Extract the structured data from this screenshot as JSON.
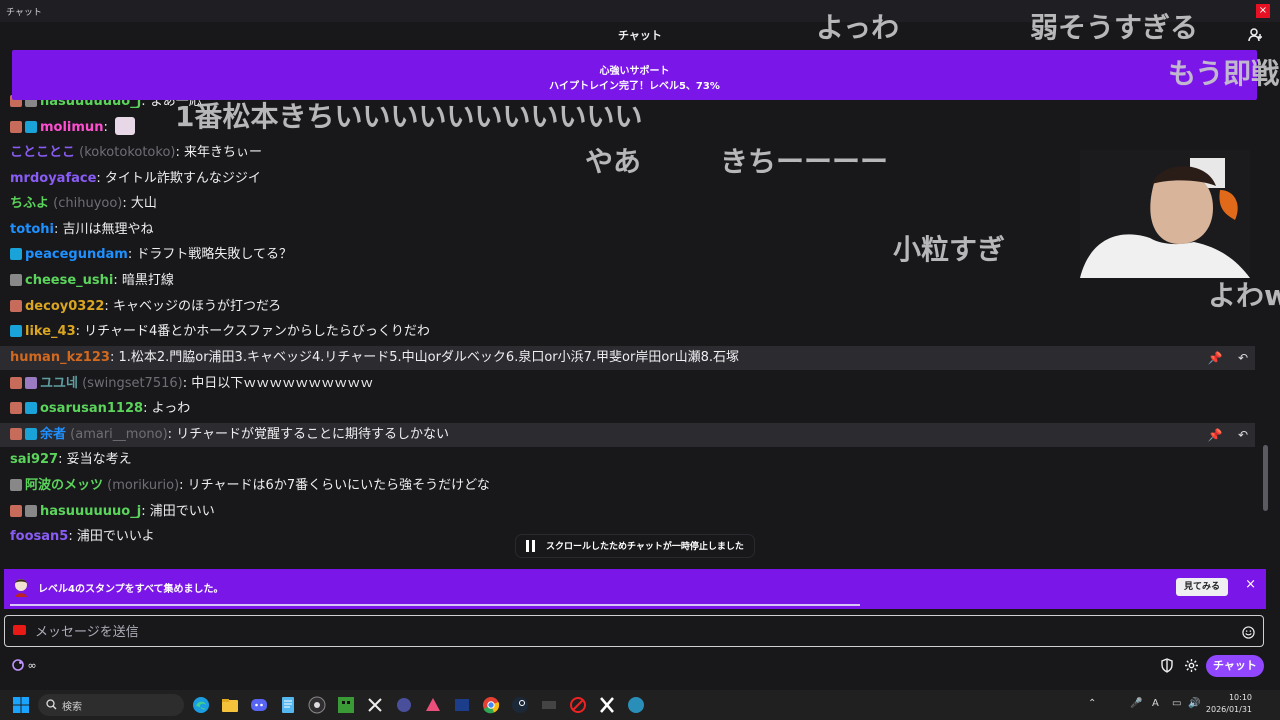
{
  "window": {
    "title": "チャット",
    "close": "×"
  },
  "header": {
    "title": "チャット"
  },
  "hype_train": {
    "line1": "心強いサポート",
    "line2": "ハイプトレイン完了！レベル5、73%"
  },
  "colors": {
    "accent": "#9147ff",
    "banner": "#7b16e9",
    "bg": "#18181b"
  },
  "messages": [
    {
      "badges": [
        "sub",
        "bot"
      ],
      "user": "hasuuuuuuo_j",
      "login": "",
      "text": "まあ一応",
      "color": "#5bd45b"
    },
    {
      "badges": [
        "sub",
        "crown"
      ],
      "user": "molimun",
      "login": "",
      "text": "",
      "color": "#ff4fd0"
    },
    {
      "badges": [],
      "user": "ことことこ",
      "login": "(kokotokotoko)",
      "text": "来年きちぃー",
      "color": "#8a5cf6"
    },
    {
      "badges": [],
      "user": "mrdoyaface",
      "login": "",
      "text": "タイトル詐欺すんなジジイ",
      "color": "#8a5cf6"
    },
    {
      "badges": [],
      "user": "ちふよ",
      "login": "(chihuyoo)",
      "text": "大山",
      "color": "#5bd45b"
    },
    {
      "badges": [],
      "user": "totohi",
      "login": "",
      "text": "吉川は無理やね",
      "color": "#1e90ff"
    },
    {
      "badges": [
        "crown"
      ],
      "user": "peacegundam",
      "login": "",
      "text": "ドラフト戦略失敗してる？",
      "color": "#1e90ff"
    },
    {
      "badges": [
        "bot"
      ],
      "user": "cheese_ushi",
      "login": "",
      "text": "暗黒打線",
      "color": "#5bd45b"
    },
    {
      "badges": [
        "sub"
      ],
      "user": "decoy0322",
      "login": "",
      "text": "キャベッジのほうが打つだろ",
      "color": "#daa520"
    },
    {
      "badges": [
        "crown"
      ],
      "user": "like_43",
      "login": "",
      "text": "リチャード4番とかホークスファンからしたらびっくりだわ",
      "color": "#daa520"
    },
    {
      "badges": [],
      "user": "human_kz123",
      "login": "",
      "text": "1.松本2.門脇or浦田3.キャベッジ4.リチャード5.中山orダルベック6.泉口or小浜7.甲斐or岸田or山瀬8.石塚",
      "color": "#d2691e",
      "hl": true
    },
    {
      "badges": [
        "sub",
        "mini"
      ],
      "user": "ユユ네",
      "login": "(swingset7516)",
      "text": "中日以下ｗｗｗｗｗｗｗｗｗｗ",
      "color": "#5f9ea0"
    },
    {
      "badges": [
        "sub",
        "crown"
      ],
      "user": "osarusan1128",
      "login": "",
      "text": "よっわ",
      "color": "#5bd45b"
    },
    {
      "badges": [
        "sub",
        "crown"
      ],
      "user": "余者",
      "login": "(amari__mono)",
      "text": "リチャードが覚醒することに期待するしかない",
      "color": "#1e90ff",
      "hl": true
    },
    {
      "badges": [],
      "user": "sai927",
      "login": "",
      "text": "妥当な考え",
      "color": "#5bd45b"
    },
    {
      "badges": [
        "bot"
      ],
      "user": "阿波のメッツ",
      "login": "(morikurio)",
      "text": "リチャードは6か7番くらいにいたら強そうだけどな",
      "color": "#5bd45b"
    },
    {
      "badges": [
        "sub",
        "bot"
      ],
      "user": "hasuuuuuuo_j",
      "login": "",
      "text": "浦田でいい",
      "color": "#5bd45b"
    },
    {
      "badges": [],
      "user": "foosan5",
      "login": "",
      "text": "浦田でいいよ",
      "color": "#8a5cf6"
    }
  ],
  "overlays": {
    "yowa": "よっわ",
    "weak": "弱そうすぎる",
    "mou": "もう即戦",
    "ichiban": "1番松本きちいいいいいいいいいいい",
    "yaa": "やあ",
    "kichi": "きちーーーー",
    "kotsubu": "小粒すぎ",
    "yowa2": "よわw"
  },
  "paused": {
    "text": "スクロールしたためチャットが一時停止しました"
  },
  "stamp_banner": {
    "text": "レベル4のスタンプをすべて集めました。",
    "button": "見てみる",
    "close": "×",
    "progress": 0.68
  },
  "input": {
    "placeholder": "メッセージを送信"
  },
  "footer": {
    "points": "∞",
    "chat_button": "チャット"
  },
  "taskbar": {
    "search": "検索",
    "time": "10:10",
    "date": "2026/01/31"
  }
}
